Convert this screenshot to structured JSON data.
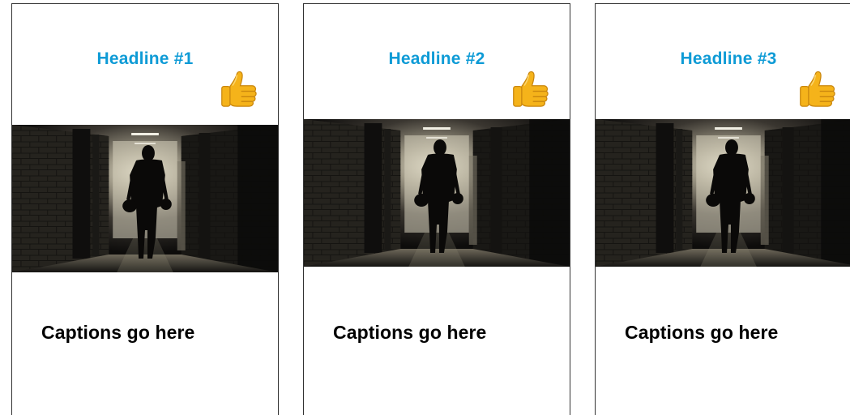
{
  "theme": {
    "headline_color": "#0e9bd6",
    "caption_color": "#000000",
    "card_border": "#333333"
  },
  "cards": [
    {
      "headline": "Headline #1",
      "caption": "Captions go here",
      "reaction_icon": "thumbs-up-icon",
      "image": "hallway-silhouette-player-photo"
    },
    {
      "headline": "Headline #2",
      "caption": "Captions go here",
      "reaction_icon": "thumbs-up-icon",
      "image": "hallway-silhouette-player-photo"
    },
    {
      "headline": "Headline #3",
      "caption": "Captions go here",
      "reaction_icon": "thumbs-up-icon",
      "image": "hallway-silhouette-player-photo"
    }
  ]
}
